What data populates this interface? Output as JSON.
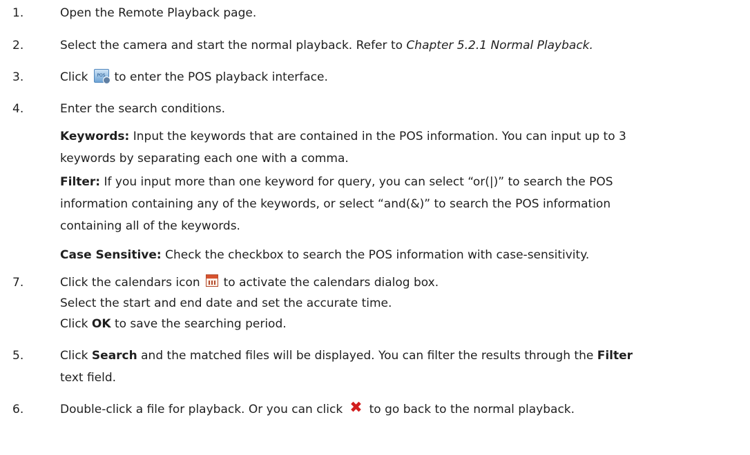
{
  "steps": [
    {
      "num": "1.",
      "text": "Open the Remote Playback page."
    },
    {
      "num": "2.",
      "text": "Select the camera and start the normal playback. Refer to ",
      "italic": "Chapter 5.2.1 Normal Playback."
    },
    {
      "num": "3.",
      "before": "Click",
      "icon": "pos-playback-icon",
      "icon_text": "POS",
      "after": "to enter the POS playback interface."
    },
    {
      "num": "4.",
      "text": "Enter the search conditions."
    },
    {
      "num": "7.",
      "before": "Click the calendars icon",
      "icon": "calendar-icon",
      "after": "to activate the calendars dialog box."
    },
    {
      "num": "5.",
      "before": "Click ",
      "bold1": "Search",
      "mid": " and the matched files will be displayed. You can filter the results through the ",
      "bold2": "Filter",
      "cont": "text field."
    },
    {
      "num": "6.",
      "before": "Double-click a file for playback. Or you can click",
      "icon": "close-icon",
      "after": "to go back to the normal playback."
    }
  ],
  "conditions": {
    "keywords": {
      "label": "Keywords:",
      "text1": " Input the keywords that are contained in the POS information. You can input up to 3",
      "text2": "keywords by separating each one with a comma."
    },
    "filter": {
      "label": "Filter:",
      "text1": " If you input more than one keyword for query, you can select “or(|)” to search the POS",
      "text2": "information containing any of the keywords, or select “and(&)” to search the POS information",
      "text3": "containing all of the keywords."
    },
    "case_sensitive": {
      "label": "Case Sensitive:",
      "text": " Check the checkbox to search the POS information with case-sensitivity."
    }
  },
  "calendar_substeps": {
    "line1": "Select the start and end date and set the accurate time.",
    "line2_before": "Click ",
    "line2_bold": "OK",
    "line2_after": " to save the searching period."
  },
  "colors": {
    "text": "#1f1f1f",
    "close_icon": "#d21f1f",
    "calendar_header": "#d8532f",
    "pos_icon": "#6fa4d5"
  }
}
